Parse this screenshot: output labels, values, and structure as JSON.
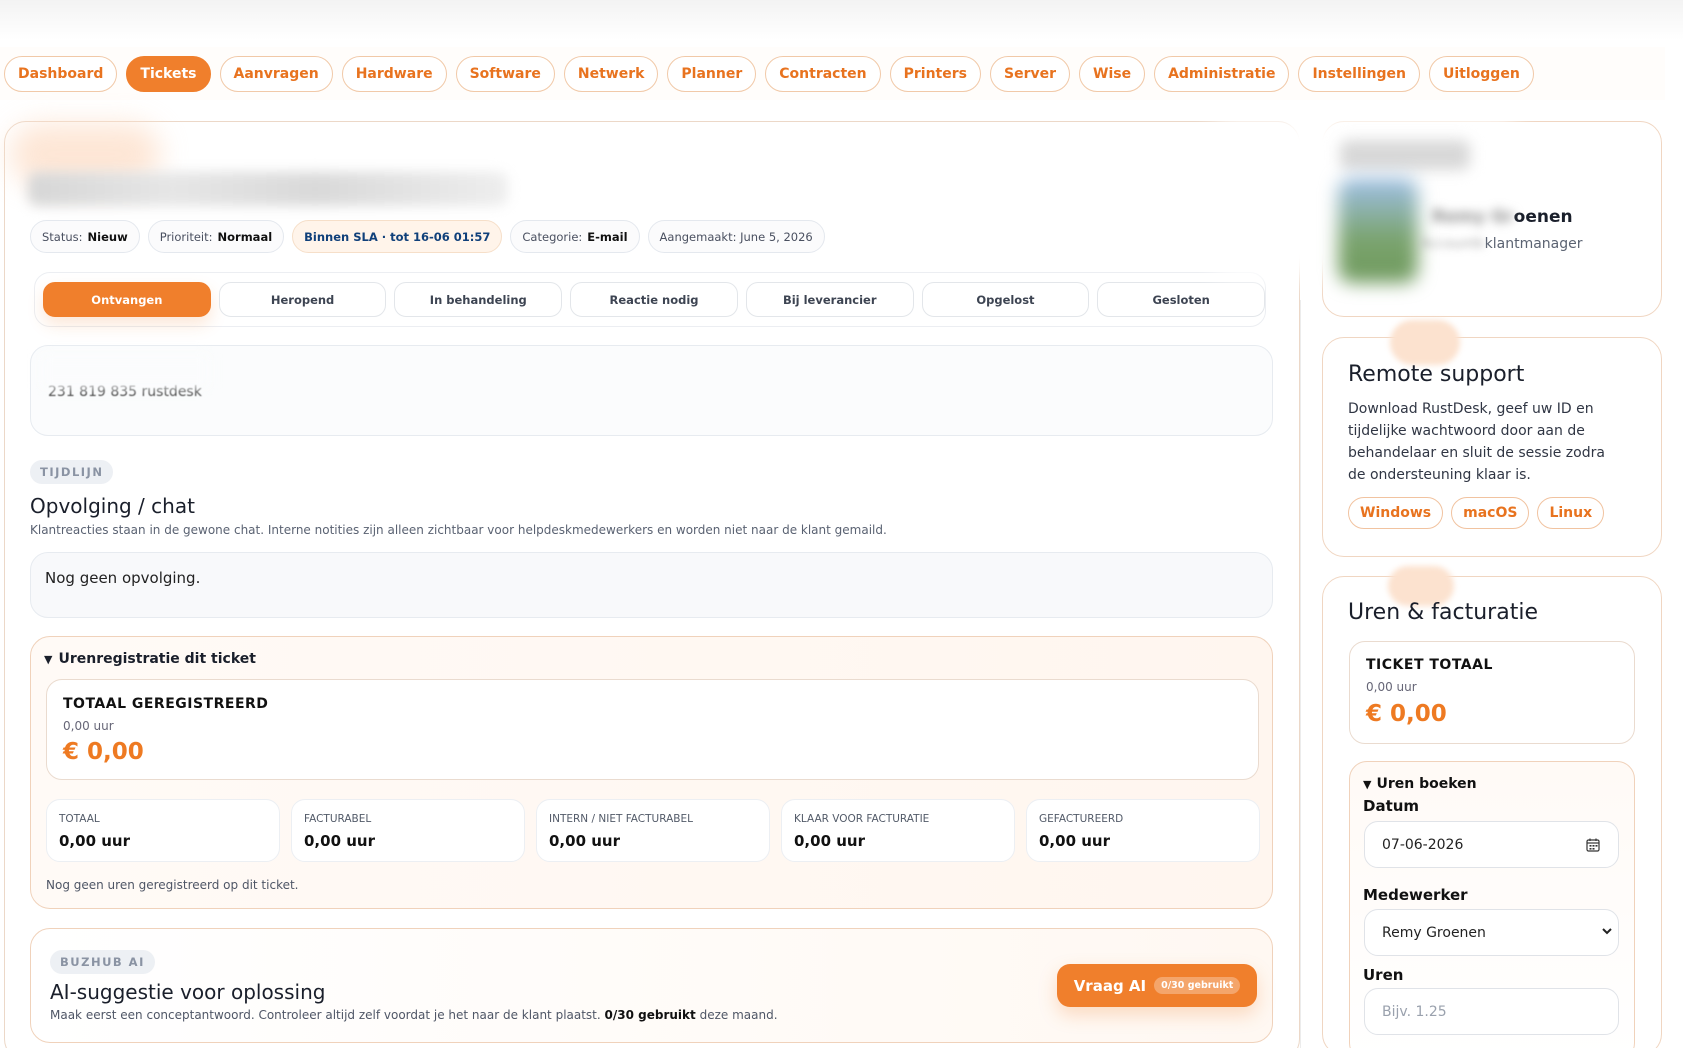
{
  "nav": {
    "items": [
      "Dashboard",
      "Tickets",
      "Aanvragen",
      "Hardware",
      "Software",
      "Netwerk",
      "Planner",
      "Contracten",
      "Printers",
      "Server",
      "Wise",
      "Administratie",
      "Instellingen",
      "Uitloggen"
    ],
    "active": "Tickets"
  },
  "ticket": {
    "meta": {
      "status_label": "Status:",
      "status_value": "Nieuw",
      "priority_label": "Prioriteit:",
      "priority_value": "Normaal",
      "sla_value": "Binnen SLA · tot 16-06 01:57",
      "category_label": "Categorie:",
      "category_value": "E-mail",
      "created": "Aangemaakt: June 5, 2026"
    },
    "statuses": [
      "Ontvangen",
      "Heropend",
      "In behandeling",
      "Reactie nodig",
      "Bij leverancier",
      "Opgelost",
      "Gesloten"
    ],
    "active_status": "Ontvangen",
    "description": "231 819 835 rustdesk"
  },
  "timeline": {
    "tag": "TIJDLIJN",
    "title": "Opvolging / chat",
    "subtitle": "Klantreacties staan in de gewone chat. Interne notities zijn alleen zichtbaar voor helpdeskmedewerkers en worden niet naar de klant gemaild.",
    "empty": "Nog geen opvolging."
  },
  "hours": {
    "summary": "Urenregistratie dit ticket",
    "total_title": "TOTAAL GEREGISTREERD",
    "total_hours": "0,00 uur",
    "total_amount": "€ 0,00",
    "stats": [
      {
        "label": "TOTAAL",
        "value": "0,00 uur"
      },
      {
        "label": "FACTURABEL",
        "value": "0,00 uur"
      },
      {
        "label": "INTERN / NIET FACTURABEL",
        "value": "0,00 uur"
      },
      {
        "label": "KLAAR VOOR FACTURATIE",
        "value": "0,00 uur"
      },
      {
        "label": "GEFACTUREERD",
        "value": "0,00 uur"
      }
    ],
    "empty": "Nog geen uren geregistreerd op dit ticket."
  },
  "ai": {
    "tag": "BUZHUB AI",
    "title": "AI-suggestie voor oplossing",
    "text_before": "Maak eerst een conceptantwoord. Controleer altijd zelf voordat je het naar de klant plaatst.",
    "text_bold": "0/30 gebruikt",
    "text_after": "deze maand.",
    "button_label": "Vraag AI",
    "button_count": "0/30 gebruikt"
  },
  "profile": {
    "name_suffix": "oenen",
    "role_suffix": "klantmanager"
  },
  "remote": {
    "title": "Remote support",
    "text": "Download RustDesk, geef uw ID en tijdelijke wachtwoord door aan de behandelaar en sluit de sessie zodra de ondersteuning klaar is.",
    "buttons": [
      "Windows",
      "macOS",
      "Linux"
    ]
  },
  "billing": {
    "title": "Uren & facturatie",
    "ticket_total_title": "TICKET TOTAAL",
    "ticket_total_hours": "0,00 uur",
    "ticket_total_amount": "€ 0,00",
    "book_summary": "Uren boeken",
    "date_label": "Datum",
    "date_value": "07-06-2026",
    "employee_label": "Medewerker",
    "employee_value": "Remy Groenen",
    "hours_label": "Uren",
    "hours_placeholder": "Bijv. 1.25"
  },
  "colors": {
    "accent": "#f07f2c",
    "accent_text": "#e8731f"
  }
}
